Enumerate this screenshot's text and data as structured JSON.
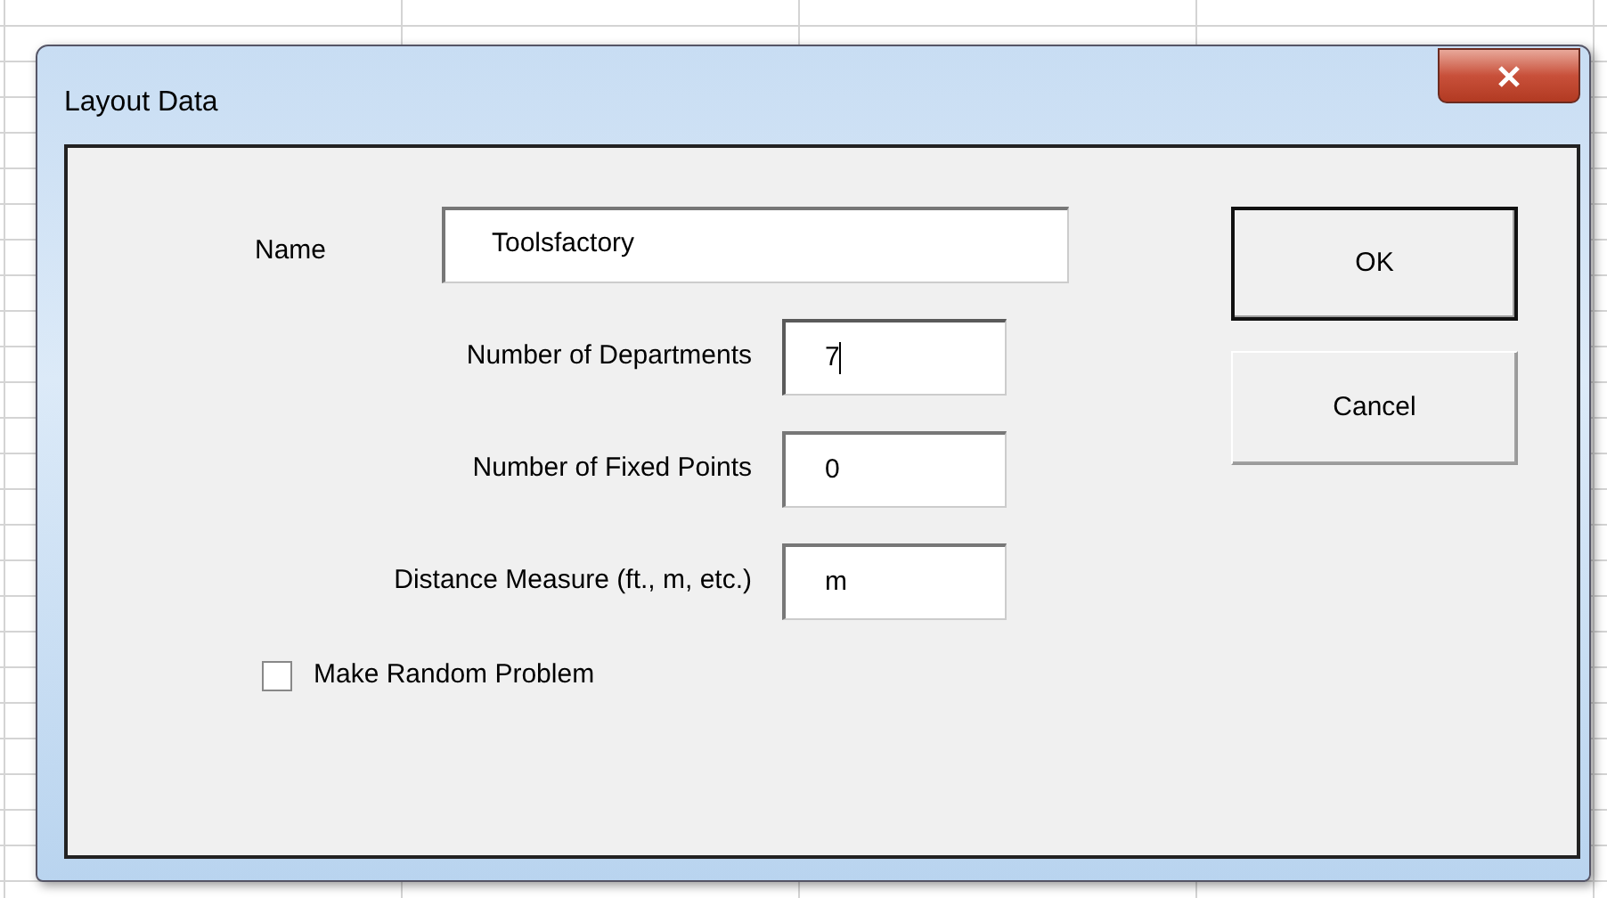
{
  "window": {
    "title": "Layout Data"
  },
  "fields": [
    {
      "kind": "wide",
      "label": "Name",
      "value": "Toolsfactory",
      "focused": false
    },
    {
      "kind": "short",
      "label": "Number of Departments",
      "value": "7",
      "focused": true
    },
    {
      "kind": "short",
      "label": "Number of Fixed Points",
      "value": "0",
      "focused": false
    },
    {
      "kind": "short",
      "label": "Distance Measure (ft., m, etc.)",
      "value": "m",
      "focused": false
    }
  ],
  "checkbox": {
    "label": "Make Random Problem",
    "checked": false
  },
  "buttons": [
    {
      "label": "OK",
      "default": true
    },
    {
      "label": "Cancel",
      "default": false
    }
  ]
}
